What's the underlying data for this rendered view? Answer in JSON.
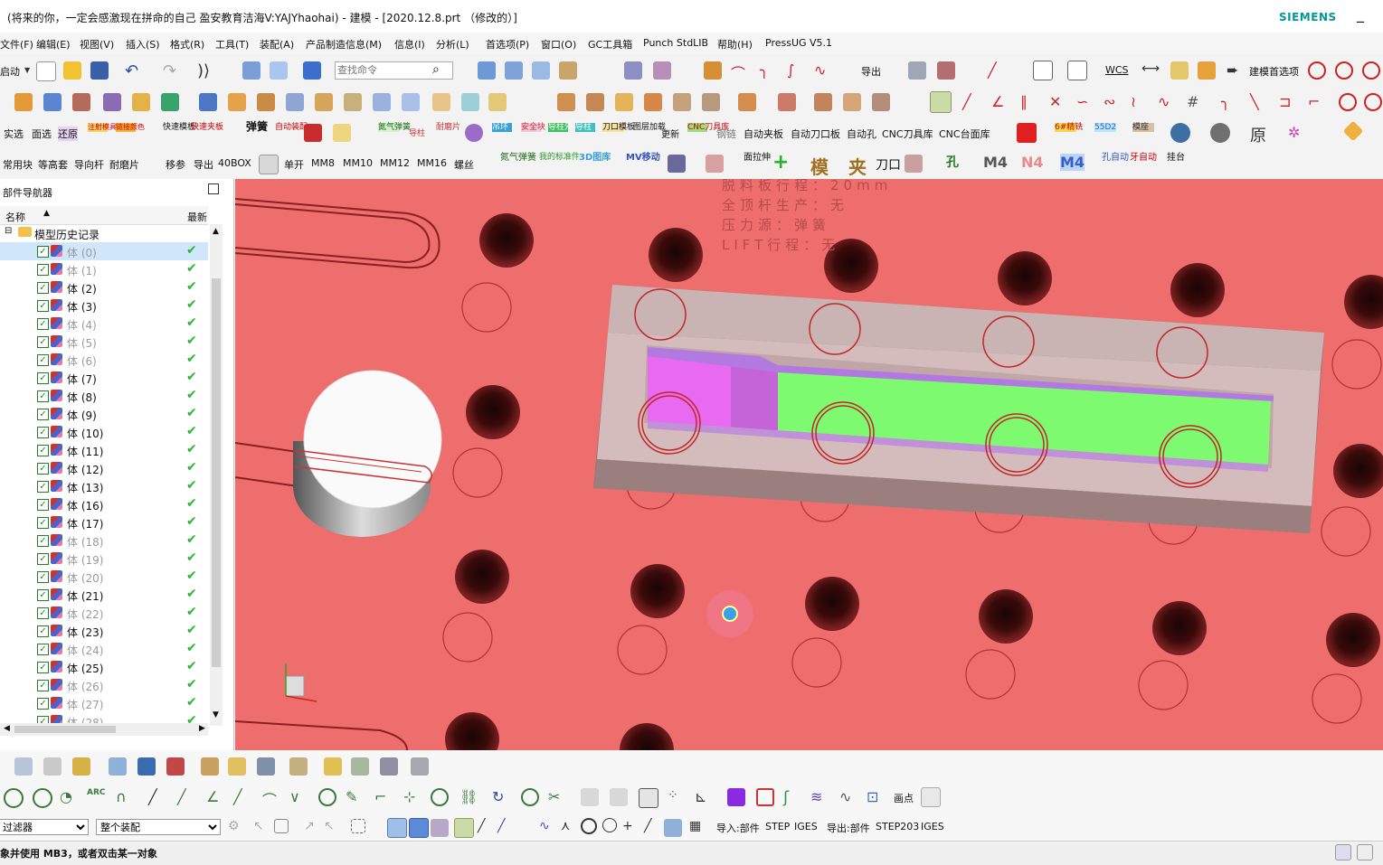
{
  "window": {
    "title": "(将来的你，一定会感激现在拼命的自己 盈安教育洁海V:YAJYhaohai) - 建模 - [2020.12.8.prt （修改的）]",
    "brand": "SIEMENS",
    "minimize": "_"
  },
  "menu": [
    "文件(F)",
    "编辑(E)",
    "视图(V)",
    "插入(S)",
    "格式(R)",
    "工具(T)",
    "装配(A)",
    "产品制造信息(M)",
    "信息(I)",
    "分析(L)",
    "首选项(P)",
    "窗口(O)",
    "GC工具箱",
    "Punch StdLIB",
    "帮助(H)",
    "PressUG V5.1"
  ],
  "toolbar1": {
    "start": "启动",
    "search_placeholder": "查找命令",
    "export": "导出",
    "wcs": "WCS",
    "modeling_prefs": "建模首选项"
  },
  "toolbar3": {
    "labels": [
      "实选",
      "面选",
      "还原",
      "注射模具",
      "链接颜色",
      "快速模板",
      "快速夹板",
      "弹簧",
      "自动装配",
      "氮气弹簧",
      "导柱",
      "耐磨片",
      "吊环",
      "安全块",
      "导柱外",
      "导柱",
      "刀口模板",
      "图层加载",
      "更新",
      "钢链",
      "自动夹板",
      "自动刀口板",
      "自动孔",
      "CNC刀具库",
      "CNC台面库",
      "6#精铣",
      "55D2",
      "模座"
    ]
  },
  "toolbar4": {
    "labels": [
      "常用块",
      "等高套",
      "导向杆",
      "耐磨片",
      "移参",
      "导出",
      "40BOX",
      "单开",
      "MM8",
      "MM10",
      "MM12",
      "MM16",
      "螺丝",
      "氮气弹簧",
      "我的标准件",
      "3D图库",
      "MV移动",
      "面拉伸",
      "模",
      "夹",
      "刀口",
      "孔",
      "M4",
      "N4",
      "M4",
      "孔自动",
      "牙自动",
      "挂台"
    ]
  },
  "navigator": {
    "title": "部件导航器",
    "col_name": "名称",
    "col_latest": "最新",
    "root": "模型历史记录",
    "items": [
      {
        "label": "体 (0)",
        "dim": true,
        "selected": true
      },
      {
        "label": "体 (1)",
        "dim": true
      },
      {
        "label": "体 (2)",
        "dim": false
      },
      {
        "label": "体 (3)",
        "dim": false
      },
      {
        "label": "体 (4)",
        "dim": true
      },
      {
        "label": "体 (5)",
        "dim": true
      },
      {
        "label": "体 (6)",
        "dim": true
      },
      {
        "label": "体 (7)",
        "dim": false
      },
      {
        "label": "体 (8)",
        "dim": false
      },
      {
        "label": "体 (9)",
        "dim": false
      },
      {
        "label": "体 (10)",
        "dim": false
      },
      {
        "label": "体 (11)",
        "dim": false
      },
      {
        "label": "体 (12)",
        "dim": false
      },
      {
        "label": "体 (13)",
        "dim": false
      },
      {
        "label": "体 (16)",
        "dim": false
      },
      {
        "label": "体 (17)",
        "dim": false
      },
      {
        "label": "体 (18)",
        "dim": true
      },
      {
        "label": "体 (19)",
        "dim": true
      },
      {
        "label": "体 (20)",
        "dim": true
      },
      {
        "label": "体 (21)",
        "dim": false
      },
      {
        "label": "体 (22)",
        "dim": true
      },
      {
        "label": "体 (23)",
        "dim": false
      },
      {
        "label": "体 (24)",
        "dim": true
      },
      {
        "label": "体 (25)",
        "dim": false
      },
      {
        "label": "体 (26)",
        "dim": true
      },
      {
        "label": "体 (27)",
        "dim": true
      },
      {
        "label": "体 (28)",
        "dim": true
      }
    ]
  },
  "viewport": {
    "annotation": [
      "脱料板行程：20mm",
      "全顶杆生产：无",
      "压力源：弹簧",
      "LIFT行程：无"
    ],
    "colors": {
      "background": "#ee6e6e",
      "pocket_face": "#7dfa6f",
      "step_face": "#e76af0",
      "block": "#cdb4b4"
    }
  },
  "bottom": {
    "filter": "过滤器",
    "assembly": "整个装配",
    "import_label": "导入:部件",
    "import_step": "STEP",
    "import_iges": "IGES",
    "export_label": "导出:部件",
    "export_step": "STEP203",
    "export_iges": "IGES",
    "draw_point": "画点",
    "status": "象并使用 MB3，或者双击某一对象"
  }
}
